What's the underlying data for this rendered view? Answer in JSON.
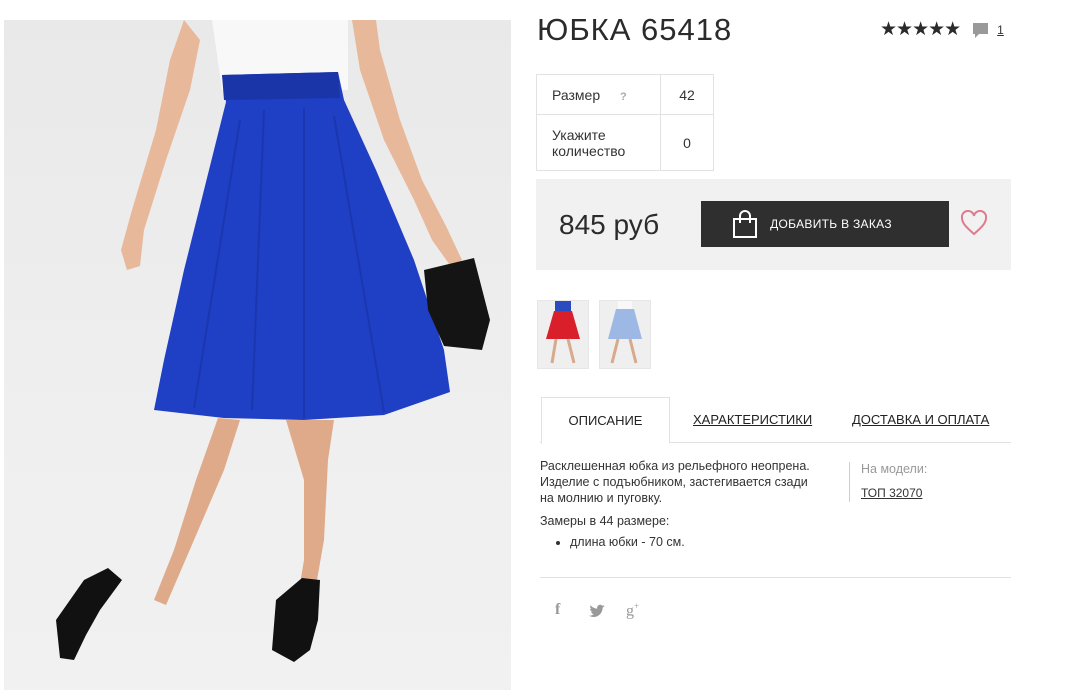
{
  "product": {
    "title": "ЮБКА 65418",
    "stars": "★★★★★",
    "comment_count": "1",
    "size_label": "Размер",
    "size_help": "?",
    "size_value": "42",
    "qty_label_1": "Укажите",
    "qty_label_2": "количество",
    "qty_value": "0",
    "price": "845 руб",
    "add_button": "ДОБАВИТЬ В ЗАКАЗ"
  },
  "tabs": {
    "description": "ОПИСАНИЕ",
    "characteristics": "ХАРАКТЕРИСТИКИ",
    "delivery": "ДОСТАВКА И ОПЛАТА"
  },
  "description": {
    "text_1": "Расклешенная юбка из рельефного неопрена.",
    "text_2": "Изделие с подъюбником, застегивается сзади",
    "text_3": "на молнию и пуговку.",
    "measures_label": "Замеры в 44 размере:",
    "measures_item": "длина юбки - 70 см.",
    "model_label": "На модели:",
    "model_link": "ТОП 32070"
  },
  "colors": {
    "skirt_main": "#1f3fc4",
    "thumb_red": "#d81f2a",
    "thumb_blue": "#9db8e4",
    "button_bg": "#2f2f2f",
    "heart": "#e07a8e"
  },
  "icons": [
    "star-icon",
    "comment-icon",
    "help-icon",
    "bag-icon",
    "heart-icon",
    "facebook-icon",
    "twitter-icon",
    "google-plus-icon"
  ]
}
